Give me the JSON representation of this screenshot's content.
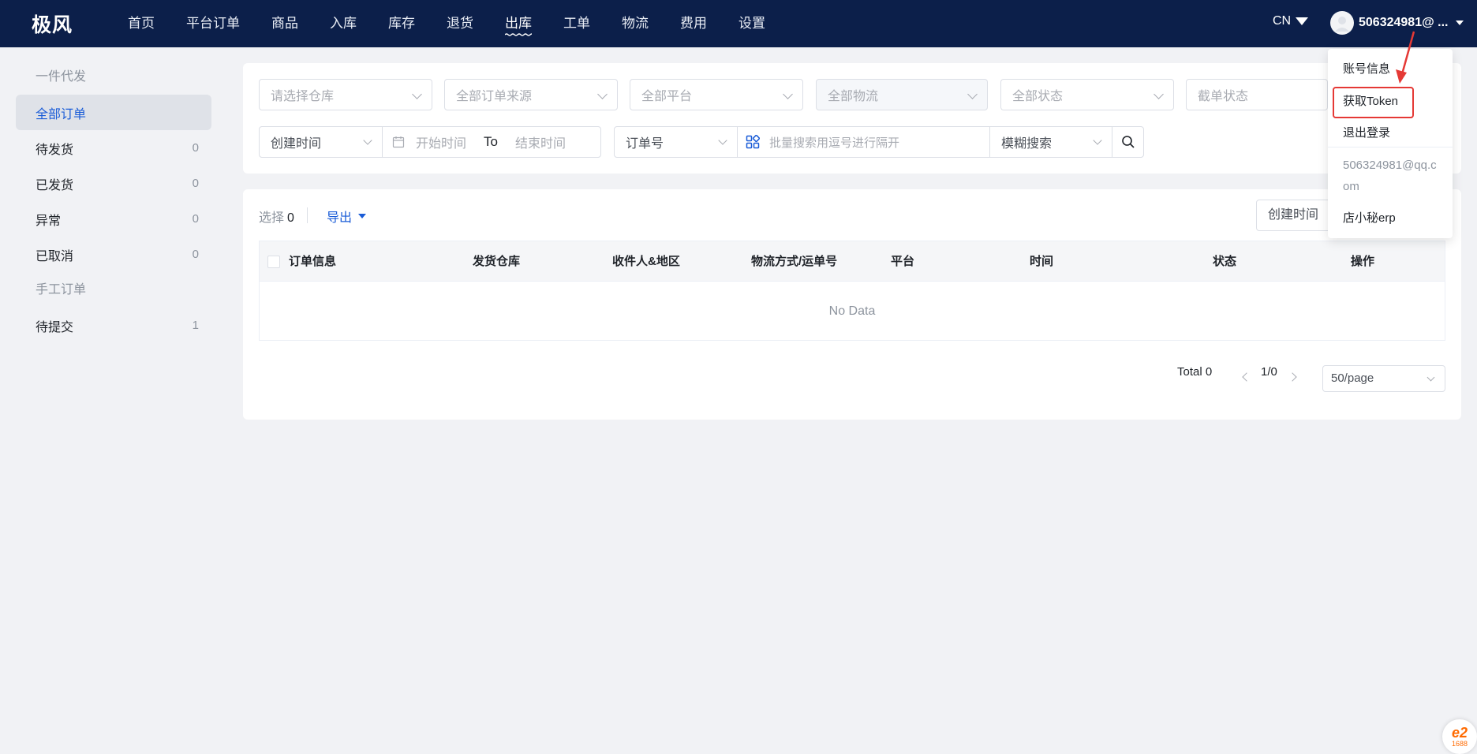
{
  "app": {
    "logo": "极风"
  },
  "nav": {
    "items": [
      {
        "label": "首页"
      },
      {
        "label": "平台订单"
      },
      {
        "label": "商品"
      },
      {
        "label": "入库"
      },
      {
        "label": "库存"
      },
      {
        "label": "退货"
      },
      {
        "label": "出库",
        "active": true
      },
      {
        "label": "工单"
      },
      {
        "label": "物流"
      },
      {
        "label": "费用"
      },
      {
        "label": "设置"
      }
    ],
    "lang": "CN",
    "user": "506324981@ ..."
  },
  "sidebar": {
    "group1": "一件代发",
    "items1": [
      {
        "label": "全部订单",
        "count": ""
      },
      {
        "label": "待发货",
        "count": "0"
      },
      {
        "label": "已发货",
        "count": "0"
      },
      {
        "label": "异常",
        "count": "0"
      },
      {
        "label": "已取消",
        "count": "0"
      }
    ],
    "group2": "手工订单",
    "items2": [
      {
        "label": "待提交",
        "count": "1"
      }
    ]
  },
  "filters": {
    "warehouse": "请选择仓库",
    "source": "全部订单来源",
    "platform": "全部平台",
    "logistics": "全部物流",
    "status": "全部状态",
    "cutoff": "截单状态",
    "time_type": "创建时间",
    "start_placeholder": "开始时间",
    "to": "To",
    "end_placeholder": "结束时间",
    "order_field": "订单号",
    "search_placeholder": "批量搜索用逗号进行隔开",
    "match_mode": "模糊搜索"
  },
  "toolbar": {
    "select_label": "选择",
    "select_count": "0",
    "export": "导出",
    "sort": "创建时间"
  },
  "table": {
    "columns": [
      "订单信息",
      "发货仓库",
      "收件人&地区",
      "物流方式/运单号",
      "平台",
      "时间",
      "状态",
      "操作"
    ],
    "empty": "No Data"
  },
  "pagination": {
    "total": "Total 0",
    "page": "1/0",
    "size": "50/page"
  },
  "user_menu": {
    "items": [
      "账号信息",
      "获取Token",
      "退出登录"
    ],
    "email": "506324981@qq.com",
    "shop": "店小秘erp"
  },
  "badge": {
    "main": "e2",
    "sub": "1688"
  },
  "colors": {
    "nav_bg": "#0c1f4a",
    "accent": "#1a5cd7",
    "highlight": "#e53935",
    "badge": "#ff6a00"
  }
}
